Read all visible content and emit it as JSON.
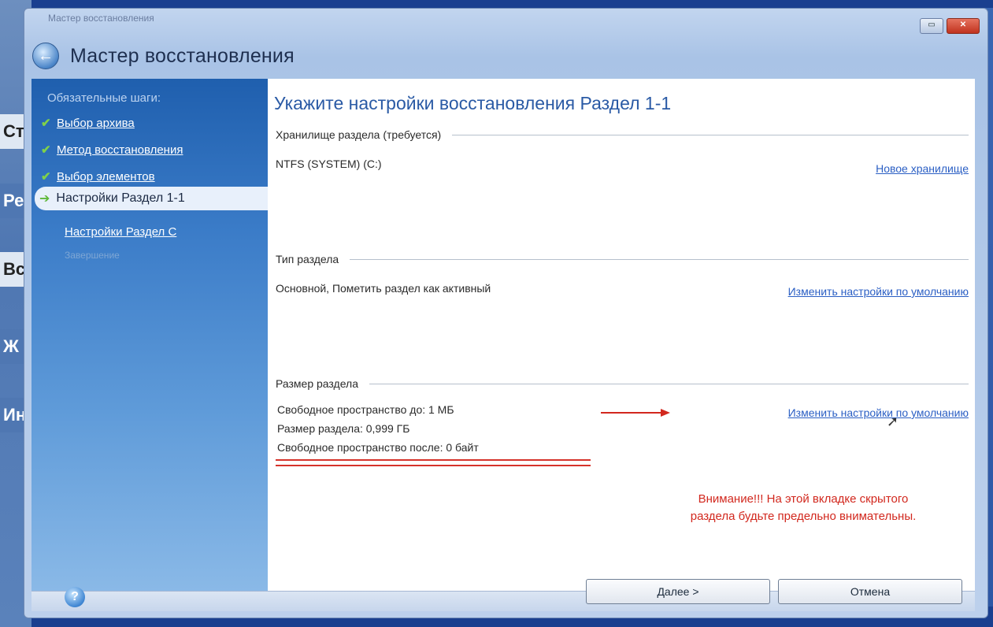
{
  "background": {
    "desktop_cells": [
      "Ст",
      "Ре",
      "Вс",
      "Ж",
      "Ин"
    ]
  },
  "window": {
    "small_title": "Мастер восстановления",
    "title": "Мастер восстановления",
    "controls": {
      "minimize_icon": "minimize-icon",
      "close_icon": "close-icon"
    }
  },
  "sidebar": {
    "header": "Обязательные шаги:",
    "done_steps": [
      {
        "label": "Выбор архива"
      },
      {
        "label": "Метод восстановления"
      },
      {
        "label": "Выбор элементов"
      }
    ],
    "current_step": "Настройки Раздел 1-1",
    "next_step": "Настройки Раздел C",
    "disabled_step": "Завершение"
  },
  "main": {
    "title": "Укажите настройки восстановления Раздел 1-1",
    "storage": {
      "heading": "Хранилище раздела (требуется)",
      "value": "NTFS (SYSTEM) (C:)",
      "link": "Новое хранилище"
    },
    "type": {
      "heading": "Тип раздела",
      "value": "Основной, Пометить раздел как активный",
      "link": "Изменить настройки по умолчанию"
    },
    "size": {
      "heading": "Размер раздела",
      "free_before": "Свободное пространство до: 1 МБ",
      "partition_size": "Размер раздела: 0,999 ГБ",
      "free_after": "Свободное пространство после: 0 байт",
      "link": "Изменить настройки по умолчанию"
    },
    "warning_line1": "Внимание!!! На этой вкладке скрытого",
    "warning_line2": "раздела будьте предельно внимательны."
  },
  "footer": {
    "next_button": "Далее >",
    "cancel_button": "Отмена"
  },
  "colors": {
    "accent": "#2a5aa5",
    "link": "#2b5fc4",
    "warning": "#d2281e"
  }
}
